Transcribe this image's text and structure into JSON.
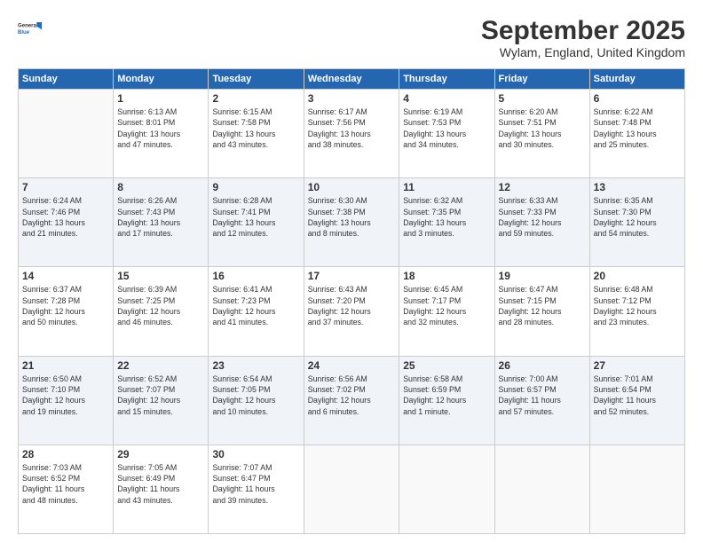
{
  "header": {
    "logo_line1": "General",
    "logo_line2": "Blue",
    "month": "September 2025",
    "location": "Wylam, England, United Kingdom"
  },
  "weekdays": [
    "Sunday",
    "Monday",
    "Tuesday",
    "Wednesday",
    "Thursday",
    "Friday",
    "Saturday"
  ],
  "weeks": [
    [
      {
        "day": "",
        "info": ""
      },
      {
        "day": "1",
        "info": "Sunrise: 6:13 AM\nSunset: 8:01 PM\nDaylight: 13 hours\nand 47 minutes."
      },
      {
        "day": "2",
        "info": "Sunrise: 6:15 AM\nSunset: 7:58 PM\nDaylight: 13 hours\nand 43 minutes."
      },
      {
        "day": "3",
        "info": "Sunrise: 6:17 AM\nSunset: 7:56 PM\nDaylight: 13 hours\nand 38 minutes."
      },
      {
        "day": "4",
        "info": "Sunrise: 6:19 AM\nSunset: 7:53 PM\nDaylight: 13 hours\nand 34 minutes."
      },
      {
        "day": "5",
        "info": "Sunrise: 6:20 AM\nSunset: 7:51 PM\nDaylight: 13 hours\nand 30 minutes."
      },
      {
        "day": "6",
        "info": "Sunrise: 6:22 AM\nSunset: 7:48 PM\nDaylight: 13 hours\nand 25 minutes."
      }
    ],
    [
      {
        "day": "7",
        "info": "Sunrise: 6:24 AM\nSunset: 7:46 PM\nDaylight: 13 hours\nand 21 minutes."
      },
      {
        "day": "8",
        "info": "Sunrise: 6:26 AM\nSunset: 7:43 PM\nDaylight: 13 hours\nand 17 minutes."
      },
      {
        "day": "9",
        "info": "Sunrise: 6:28 AM\nSunset: 7:41 PM\nDaylight: 13 hours\nand 12 minutes."
      },
      {
        "day": "10",
        "info": "Sunrise: 6:30 AM\nSunset: 7:38 PM\nDaylight: 13 hours\nand 8 minutes."
      },
      {
        "day": "11",
        "info": "Sunrise: 6:32 AM\nSunset: 7:35 PM\nDaylight: 13 hours\nand 3 minutes."
      },
      {
        "day": "12",
        "info": "Sunrise: 6:33 AM\nSunset: 7:33 PM\nDaylight: 12 hours\nand 59 minutes."
      },
      {
        "day": "13",
        "info": "Sunrise: 6:35 AM\nSunset: 7:30 PM\nDaylight: 12 hours\nand 54 minutes."
      }
    ],
    [
      {
        "day": "14",
        "info": "Sunrise: 6:37 AM\nSunset: 7:28 PM\nDaylight: 12 hours\nand 50 minutes."
      },
      {
        "day": "15",
        "info": "Sunrise: 6:39 AM\nSunset: 7:25 PM\nDaylight: 12 hours\nand 46 minutes."
      },
      {
        "day": "16",
        "info": "Sunrise: 6:41 AM\nSunset: 7:23 PM\nDaylight: 12 hours\nand 41 minutes."
      },
      {
        "day": "17",
        "info": "Sunrise: 6:43 AM\nSunset: 7:20 PM\nDaylight: 12 hours\nand 37 minutes."
      },
      {
        "day": "18",
        "info": "Sunrise: 6:45 AM\nSunset: 7:17 PM\nDaylight: 12 hours\nand 32 minutes."
      },
      {
        "day": "19",
        "info": "Sunrise: 6:47 AM\nSunset: 7:15 PM\nDaylight: 12 hours\nand 28 minutes."
      },
      {
        "day": "20",
        "info": "Sunrise: 6:48 AM\nSunset: 7:12 PM\nDaylight: 12 hours\nand 23 minutes."
      }
    ],
    [
      {
        "day": "21",
        "info": "Sunrise: 6:50 AM\nSunset: 7:10 PM\nDaylight: 12 hours\nand 19 minutes."
      },
      {
        "day": "22",
        "info": "Sunrise: 6:52 AM\nSunset: 7:07 PM\nDaylight: 12 hours\nand 15 minutes."
      },
      {
        "day": "23",
        "info": "Sunrise: 6:54 AM\nSunset: 7:05 PM\nDaylight: 12 hours\nand 10 minutes."
      },
      {
        "day": "24",
        "info": "Sunrise: 6:56 AM\nSunset: 7:02 PM\nDaylight: 12 hours\nand 6 minutes."
      },
      {
        "day": "25",
        "info": "Sunrise: 6:58 AM\nSunset: 6:59 PM\nDaylight: 12 hours\nand 1 minute."
      },
      {
        "day": "26",
        "info": "Sunrise: 7:00 AM\nSunset: 6:57 PM\nDaylight: 11 hours\nand 57 minutes."
      },
      {
        "day": "27",
        "info": "Sunrise: 7:01 AM\nSunset: 6:54 PM\nDaylight: 11 hours\nand 52 minutes."
      }
    ],
    [
      {
        "day": "28",
        "info": "Sunrise: 7:03 AM\nSunset: 6:52 PM\nDaylight: 11 hours\nand 48 minutes."
      },
      {
        "day": "29",
        "info": "Sunrise: 7:05 AM\nSunset: 6:49 PM\nDaylight: 11 hours\nand 43 minutes."
      },
      {
        "day": "30",
        "info": "Sunrise: 7:07 AM\nSunset: 6:47 PM\nDaylight: 11 hours\nand 39 minutes."
      },
      {
        "day": "",
        "info": ""
      },
      {
        "day": "",
        "info": ""
      },
      {
        "day": "",
        "info": ""
      },
      {
        "day": "",
        "info": ""
      }
    ]
  ]
}
